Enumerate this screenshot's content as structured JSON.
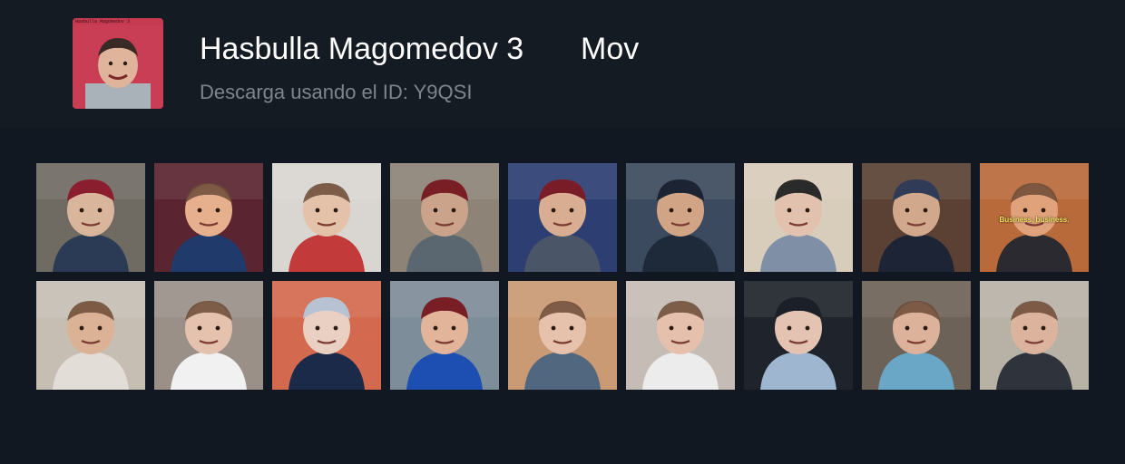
{
  "pack": {
    "title": "Hasbulla Magomedov 3",
    "type": "Mov",
    "subtitle": "Descarga usando el ID: Y9QSI",
    "cover_text": "Hasbulla Magomedov 3",
    "cover_color": "#c63a52"
  },
  "stickers": [
    {
      "id": 1,
      "bg": "#6f6a62",
      "fg": "#2b3b55",
      "skin": "#d9b59b",
      "hat": "#8b1e2e"
    },
    {
      "id": 2,
      "bg": "#5a2430",
      "fg": "#1f3a6b",
      "skin": "#e6b08e",
      "hat": ""
    },
    {
      "id": 3,
      "bg": "#d9d6d1",
      "fg": "#c23a3a",
      "skin": "#e4c2aa",
      "hat": ""
    },
    {
      "id": 4,
      "bg": "#8d8477",
      "fg": "#5b6770",
      "skin": "#caa38a",
      "hat": "#7a1e25"
    },
    {
      "id": 5,
      "bg": "#2c3e72",
      "fg": "#4b5568",
      "skin": "#d8ad92",
      "hat": "#7a1c28"
    },
    {
      "id": 6,
      "bg": "#3b4a5e",
      "fg": "#1e2a3a",
      "skin": "#d2a486",
      "hat": "#1c2333"
    },
    {
      "id": 7,
      "bg": "#d8cdbb",
      "fg": "#7f8fa6",
      "skin": "#e2c2ae",
      "hat": "#2a2a2a"
    },
    {
      "id": 8,
      "bg": "#5a4133",
      "fg": "#1d2436",
      "skin": "#d1a88c",
      "hat": "#2f3b57"
    },
    {
      "id": 9,
      "bg": "#b96a3a",
      "fg": "#2a2a30",
      "skin": "#e0a27a",
      "hat": "",
      "caption": "Business, business."
    },
    {
      "id": 10,
      "bg": "#c6beb3",
      "fg": "#e2ddd6",
      "skin": "#dcb296",
      "hat": ""
    },
    {
      "id": 11,
      "bg": "#9a9088",
      "fg": "#f1f1f1",
      "skin": "#e4c2ae",
      "hat": ""
    },
    {
      "id": 12,
      "bg": "#d36a4f",
      "fg": "#1a2a48",
      "skin": "#ead0c2",
      "hat": "#b7c3d3"
    },
    {
      "id": 13,
      "bg": "#7e8d9a",
      "fg": "#1d4fb3",
      "skin": "#e2b59a",
      "hat": "#7a1e25"
    },
    {
      "id": 14,
      "bg": "#c99a74",
      "fg": "#51667f",
      "skin": "#e6c2ad",
      "hat": ""
    },
    {
      "id": 15,
      "bg": "#c5bcb5",
      "fg": "#ececec",
      "skin": "#e5c1ad",
      "hat": ""
    },
    {
      "id": 16,
      "bg": "#1f232b",
      "fg": "#9fb6d1",
      "skin": "#e4c3b3",
      "hat": "#1b1f27"
    },
    {
      "id": 17,
      "bg": "#6d6257",
      "fg": "#6aa7c7",
      "skin": "#dcb29a",
      "hat": ""
    },
    {
      "id": 18,
      "bg": "#b8b1a6",
      "fg": "#2f343c",
      "skin": "#dcb39c",
      "hat": ""
    }
  ]
}
